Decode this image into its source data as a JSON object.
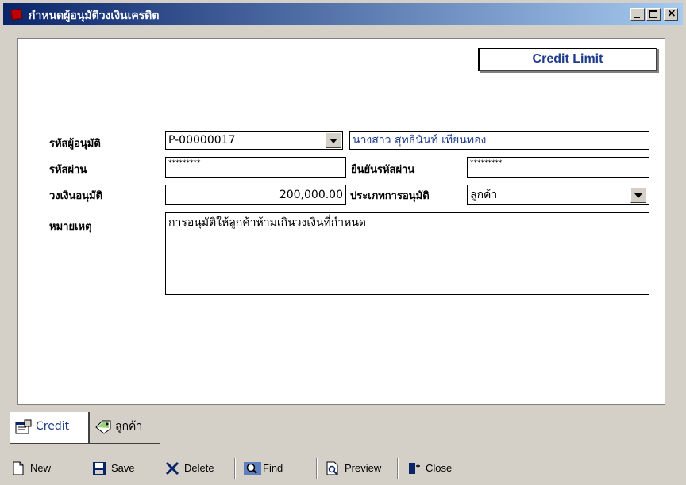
{
  "window": {
    "title": "กำหนดผู้อนุมัติวงเงินเครดิต"
  },
  "badge": "Credit Limit",
  "form": {
    "approver_code_label": "รหัสผู้อนุมัติ",
    "approver_code": "P-00000017",
    "approver_name": "นางสาว สุทธินันท์ เทียนทอง",
    "password_label": "รหัสผ่าน",
    "password_mask": "*********",
    "confirm_label": "ยืนยันรหัสผ่าน",
    "confirm_mask": "*********",
    "limit_label": "วงเงินอนุมัติ",
    "limit_value": "200,000.00",
    "type_label": "ประเภทการอนุมัติ",
    "type_value": "ลูกค้า",
    "remark_label": "หมายเหตุ",
    "remark_value": "การอนุมัติให้ลูกค้าห้ามเกินวงเงินที่กำหนด"
  },
  "tabs": [
    {
      "label": "Credit",
      "icon": "properties-icon"
    },
    {
      "label": "ลูกค้า",
      "icon": "tag-icon"
    }
  ],
  "toolbar": {
    "new": "New",
    "save": "Save",
    "delete": "Delete",
    "find": "Find",
    "preview": "Preview",
    "close": "Close"
  }
}
